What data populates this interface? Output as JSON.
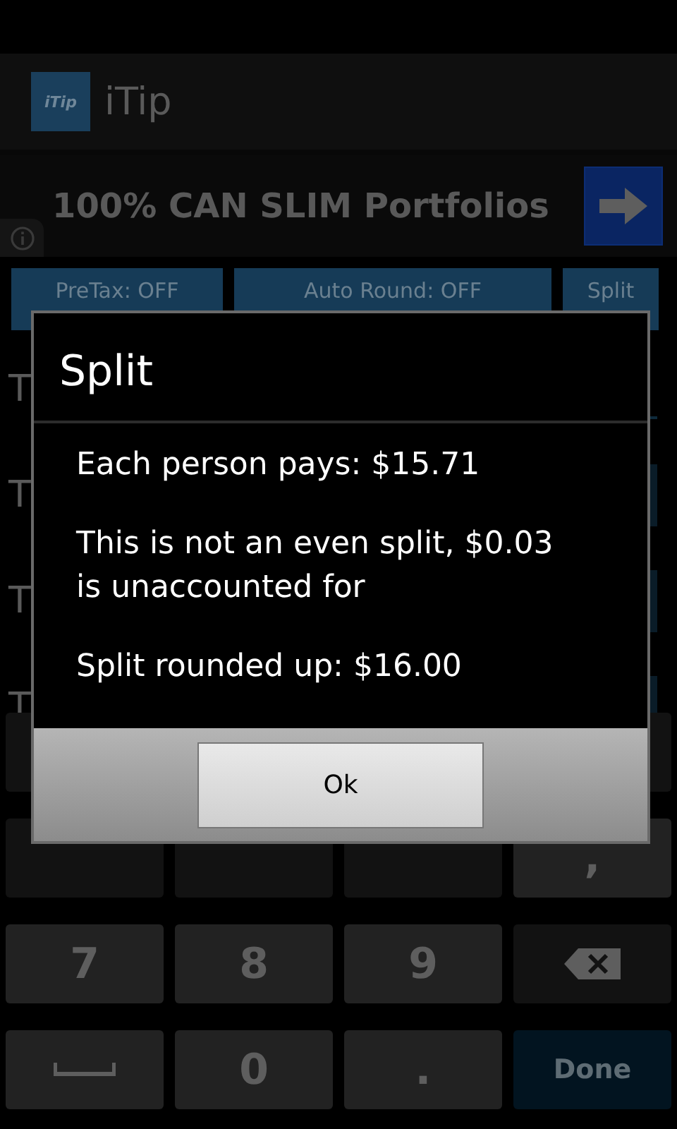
{
  "app_bar": {
    "logo_text": "iTip",
    "title": "iTip"
  },
  "ad_banner": {
    "text": "100% CAN SLIM Portfolios"
  },
  "toggles": [
    {
      "label": "PreTax: OFF"
    },
    {
      "label": "Auto Round: OFF"
    },
    {
      "label": "Split"
    }
  ],
  "rows": [
    {
      "kind": "input",
      "label": "T"
    },
    {
      "kind": "stepper",
      "label": "T"
    },
    {
      "kind": "stepper",
      "label": "T"
    },
    {
      "kind": "stepper",
      "label": "T"
    }
  ],
  "keypad": [
    [
      {
        "kind": "blank"
      },
      {
        "kind": "covered"
      },
      {
        "kind": "covered"
      },
      {
        "kind": "blank"
      }
    ],
    [
      {
        "kind": "blank"
      },
      {
        "kind": "blank"
      },
      {
        "kind": "blank"
      },
      {
        "kind": "text",
        "label": ","
      }
    ],
    [
      {
        "kind": "text",
        "label": "7"
      },
      {
        "kind": "text",
        "label": "8"
      },
      {
        "kind": "text",
        "label": "9"
      },
      {
        "kind": "backspace"
      }
    ],
    [
      {
        "kind": "space"
      },
      {
        "kind": "text",
        "label": "0"
      },
      {
        "kind": "text",
        "label": "."
      },
      {
        "kind": "done",
        "label": "Done"
      }
    ]
  ],
  "dialog": {
    "title": "Split",
    "messages": [
      "Each person pays: $15.71",
      "This is not an even split, $0.03 is unaccounted for",
      "Split rounded up: $16.00"
    ],
    "button": "Ok"
  }
}
